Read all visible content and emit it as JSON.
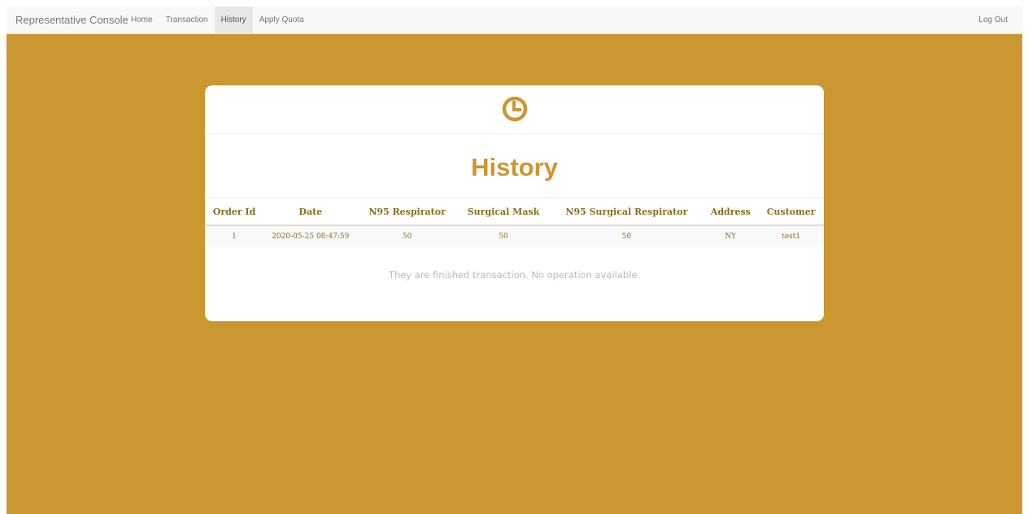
{
  "navbar": {
    "brand": "Representative Console",
    "items": [
      {
        "label": "Home",
        "active": false
      },
      {
        "label": "Transaction",
        "active": false
      },
      {
        "label": "History",
        "active": true
      },
      {
        "label": "Apply Quota",
        "active": false
      }
    ],
    "logout_label": "Log Out"
  },
  "card": {
    "icon": "clock-icon",
    "title": "History",
    "table": {
      "headers": [
        "Order Id",
        "Date",
        "N95 Respirator",
        "Surgical Mask",
        "N95 Surgical Respirator",
        "Address",
        "Customer"
      ],
      "rows": [
        [
          "1",
          "2020-05-25 08:47:59",
          "50",
          "50",
          "50",
          "NY",
          "test1"
        ]
      ]
    },
    "note": "They are finished transaction. No operation available."
  },
  "colors": {
    "accent": "#cb9731",
    "table_text": "#8a6d1d",
    "navbar_bg": "#f8f8f8"
  }
}
